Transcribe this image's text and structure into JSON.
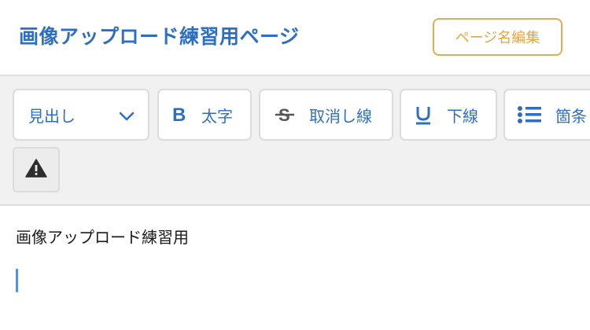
{
  "header": {
    "title": "画像アップロード練習用ページ",
    "edit_name_button": "ページ名編集"
  },
  "toolbar": {
    "heading_select": {
      "label": "見出し",
      "icon": "chevron-down-icon"
    },
    "bold": {
      "label": "太字",
      "icon": "bold-icon"
    },
    "strikethrough": {
      "label": "取消し線",
      "icon": "strikethrough-icon"
    },
    "underline": {
      "label": "下線",
      "icon": "underline-icon"
    },
    "list": {
      "label": "箇条",
      "icon": "bullet-list-icon"
    },
    "warning": {
      "icon": "warning-icon"
    }
  },
  "editor": {
    "text": "画像アップロード練習用"
  },
  "colors": {
    "accent": "#2f6fc1",
    "edit_button": "#e3ad4e",
    "toolbar_bg": "#f1f1f1"
  }
}
